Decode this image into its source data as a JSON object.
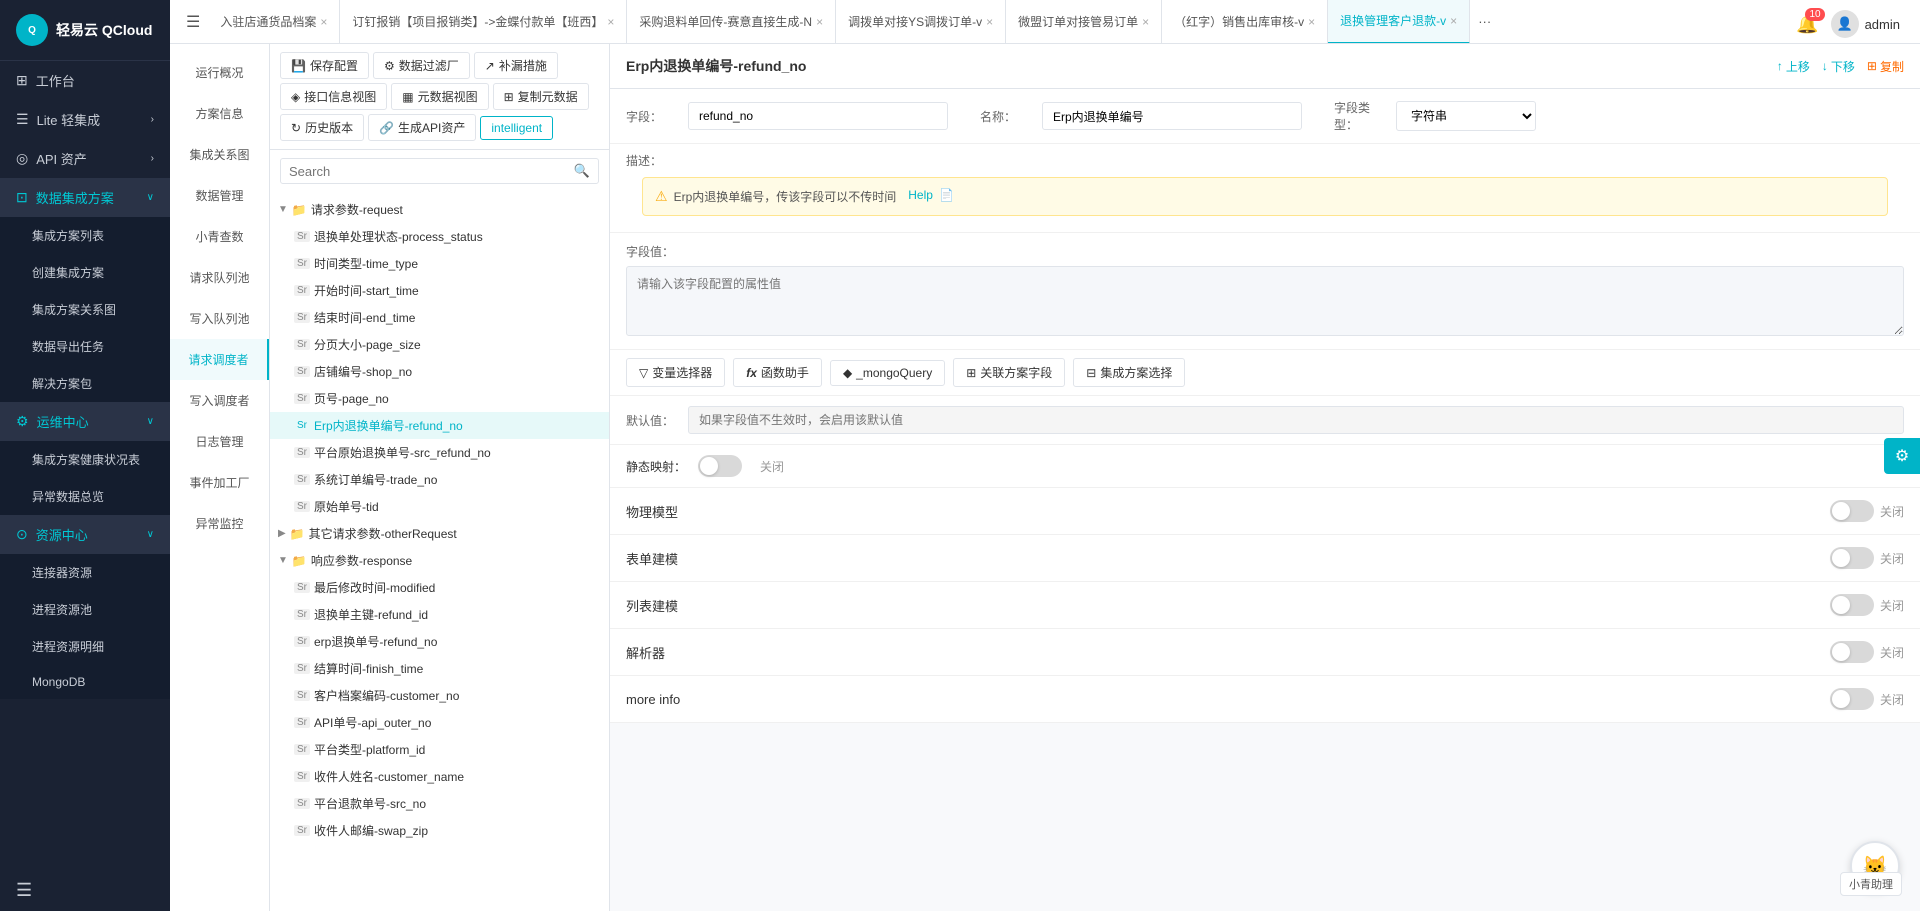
{
  "logo": {
    "text": "轻易云 QCloud"
  },
  "header": {
    "notification_count": "10",
    "username": "admin"
  },
  "tabs": [
    {
      "id": "tab1",
      "label": "入驻店通货品档案",
      "active": false,
      "closable": true
    },
    {
      "id": "tab2",
      "label": "订钉报销【项目报销类】->金蝶付款单【班西】",
      "active": false,
      "closable": true
    },
    {
      "id": "tab3",
      "label": "采购退料单回传-赛意直接生成-N",
      "active": false,
      "closable": true
    },
    {
      "id": "tab4",
      "label": "调拨单对接YS调拨订单-v",
      "active": false,
      "closable": true
    },
    {
      "id": "tab5",
      "label": "微盟订单对接管易订单",
      "active": false,
      "closable": true
    },
    {
      "id": "tab6",
      "label": "（红字）销售出库审核-v",
      "active": false,
      "closable": true
    },
    {
      "id": "tab7",
      "label": "退换管理客户退款-v",
      "active": true,
      "closable": true
    }
  ],
  "sidebar": {
    "logo_text": "轻易云",
    "logo_sub": "QCloud",
    "items": [
      {
        "id": "workbench",
        "label": "工作台",
        "icon": "⊞",
        "expandable": false
      },
      {
        "id": "lite",
        "label": "Lite 轻集成",
        "icon": "☰",
        "expandable": true
      },
      {
        "id": "api",
        "label": "API 资产",
        "icon": "◎",
        "expandable": true
      },
      {
        "id": "data-integration",
        "label": "数据集成方案",
        "icon": "⊡",
        "expandable": true,
        "active": true,
        "children": [
          {
            "id": "integration-list",
            "label": "集成方案列表"
          },
          {
            "id": "create-integration",
            "label": "创建集成方案"
          },
          {
            "id": "integration-relation",
            "label": "集成方案关系图"
          },
          {
            "id": "data-management",
            "label": "数据导出任务"
          },
          {
            "id": "solution-pkg",
            "label": "解决方案包"
          }
        ]
      },
      {
        "id": "ops-center",
        "label": "运维中心",
        "icon": "⚙",
        "expandable": true,
        "active": true,
        "children": [
          {
            "id": "health-status",
            "label": "集成方案健康状况表"
          },
          {
            "id": "anomaly",
            "label": "异常数据总览"
          }
        ]
      },
      {
        "id": "resource-center",
        "label": "资源中心",
        "icon": "⊙",
        "expandable": true,
        "active": true,
        "children": [
          {
            "id": "connectors",
            "label": "连接器资源"
          },
          {
            "id": "process-pool",
            "label": "进程资源池"
          },
          {
            "id": "process-detail",
            "label": "进程资源明细"
          },
          {
            "id": "mongodb",
            "label": "MongoDB"
          }
        ]
      }
    ]
  },
  "left_nav": [
    {
      "id": "overview",
      "label": "运行概况"
    },
    {
      "id": "solution-info",
      "label": "方案信息"
    },
    {
      "id": "integration-view",
      "label": "集成关系图"
    },
    {
      "id": "data-management",
      "label": "数据管理"
    },
    {
      "id": "xiao-qing",
      "label": "小青查数"
    },
    {
      "id": "request-queue",
      "label": "请求队列池"
    },
    {
      "id": "write-queue",
      "label": "写入队列池",
      "active": true
    },
    {
      "id": "request-adjuster",
      "label": "请求调度者",
      "active": true
    },
    {
      "id": "write-adjuster",
      "label": "写入调度者"
    },
    {
      "id": "log-management",
      "label": "日志管理"
    },
    {
      "id": "event-factory",
      "label": "事件加工厂"
    },
    {
      "id": "anomaly-monitor",
      "label": "异常监控"
    }
  ],
  "toolbar": {
    "save_config": "保存配置",
    "data_filter": "数据过滤厂",
    "supplement": "补漏措施",
    "interface_view": "接口信息视图",
    "meta_view": "元数据视图",
    "copy_data": "复制元数据",
    "history": "历史版本",
    "generate_api": "生成API资产",
    "intelligent": "intelligent"
  },
  "search": {
    "placeholder": "Search"
  },
  "tree": {
    "nodes": [
      {
        "id": "request-params",
        "label": "请求参数-request",
        "type": "folder",
        "level": 0,
        "expanded": true
      },
      {
        "id": "process-status",
        "label": "退换单处理状态-process_status",
        "type": "str",
        "level": 1
      },
      {
        "id": "time-type",
        "label": "时间类型-time_type",
        "type": "str",
        "level": 1
      },
      {
        "id": "start-time",
        "label": "开始时间-start_time",
        "type": "str",
        "level": 1
      },
      {
        "id": "end-time",
        "label": "结束时间-end_time",
        "type": "str",
        "level": 1
      },
      {
        "id": "page-size",
        "label": "分页大小-page_size",
        "type": "str",
        "level": 1
      },
      {
        "id": "shop-no",
        "label": "店铺编号-shop_no",
        "type": "str",
        "level": 1
      },
      {
        "id": "page-no",
        "label": "页号-page_no",
        "type": "str",
        "level": 1
      },
      {
        "id": "refund-no",
        "label": "Erp内退换单编号-refund_no",
        "type": "str",
        "level": 1,
        "selected": true
      },
      {
        "id": "src-refund-no",
        "label": "平台原始退换单号-src_refund_no",
        "type": "str",
        "level": 1
      },
      {
        "id": "trade-no",
        "label": "系统订单编号-trade_no",
        "type": "str",
        "level": 1
      },
      {
        "id": "tid",
        "label": "原始单号-tid",
        "type": "str",
        "level": 1
      },
      {
        "id": "other-request",
        "label": "其它请求参数-otherRequest",
        "type": "folder",
        "level": 0
      },
      {
        "id": "response",
        "label": "响应参数-response",
        "type": "folder",
        "level": 0,
        "expanded": true
      },
      {
        "id": "modified",
        "label": "最后修改时间-modified",
        "type": "str",
        "level": 1
      },
      {
        "id": "refund-id",
        "label": "退换单主键-refund_id",
        "type": "str",
        "level": 1
      },
      {
        "id": "erp-refund-no",
        "label": "erp退换单号-refund_no",
        "type": "str",
        "level": 1
      },
      {
        "id": "finish-time",
        "label": "结算时间-finish_time",
        "type": "str",
        "level": 1
      },
      {
        "id": "customer-no",
        "label": "客户档案编码-customer_no",
        "type": "str",
        "level": 1
      },
      {
        "id": "api-outer-no",
        "label": "API单号-api_outer_no",
        "type": "str",
        "level": 1
      },
      {
        "id": "platform-id",
        "label": "平台类型-platform_id",
        "type": "str",
        "level": 1
      },
      {
        "id": "customer-name",
        "label": "收件人姓名-customer_name",
        "type": "str",
        "level": 1
      },
      {
        "id": "src-no",
        "label": "平台退款单号-src_no",
        "type": "str",
        "level": 1
      },
      {
        "id": "swap-zip",
        "label": "收件人邮编-swap_zip",
        "type": "str",
        "level": 1
      }
    ]
  },
  "field_detail": {
    "title": "Erp内退换单编号-refund_no",
    "actions": {
      "up": "上移",
      "down": "下移",
      "copy": "复制"
    },
    "field_label": "字段：",
    "field_value": "refund_no",
    "name_label": "名称：",
    "name_value": "Erp内退换单编号",
    "type_label": "字段类型：",
    "type_value": "字符串",
    "desc_label": "描述：",
    "desc_content": "Erp内退换单编号，传该字段可以不传时间",
    "desc_help": "Help",
    "field_val_label": "字段值：",
    "field_val_placeholder": "请输入该字段配置的属性值",
    "func_btns": [
      {
        "id": "var-selector",
        "icon": "▽",
        "label": "变量选择器"
      },
      {
        "id": "func-helper",
        "icon": "fx",
        "label": "函数助手"
      },
      {
        "id": "mongo-query",
        "icon": "◆",
        "label": "_mongoQuery"
      },
      {
        "id": "related-field",
        "icon": "⊞",
        "label": "关联方案字段"
      },
      {
        "id": "integration-select",
        "icon": "⊟",
        "label": "集成方案选择"
      }
    ],
    "default_label": "默认值：",
    "default_placeholder": "如果字段值不生效时，会启用该默认值",
    "static_map_label": "静态映射：",
    "static_map_status": "关闭",
    "physical_model_label": "物理模型",
    "physical_model_status": "关闭",
    "form_model_label": "表单建模",
    "form_model_status": "关闭",
    "list_model_label": "列表建模",
    "list_model_status": "关闭",
    "parser_label": "解析器",
    "parser_status": "关闭",
    "more_info_label": "more info",
    "more_info_status": "关闭"
  }
}
